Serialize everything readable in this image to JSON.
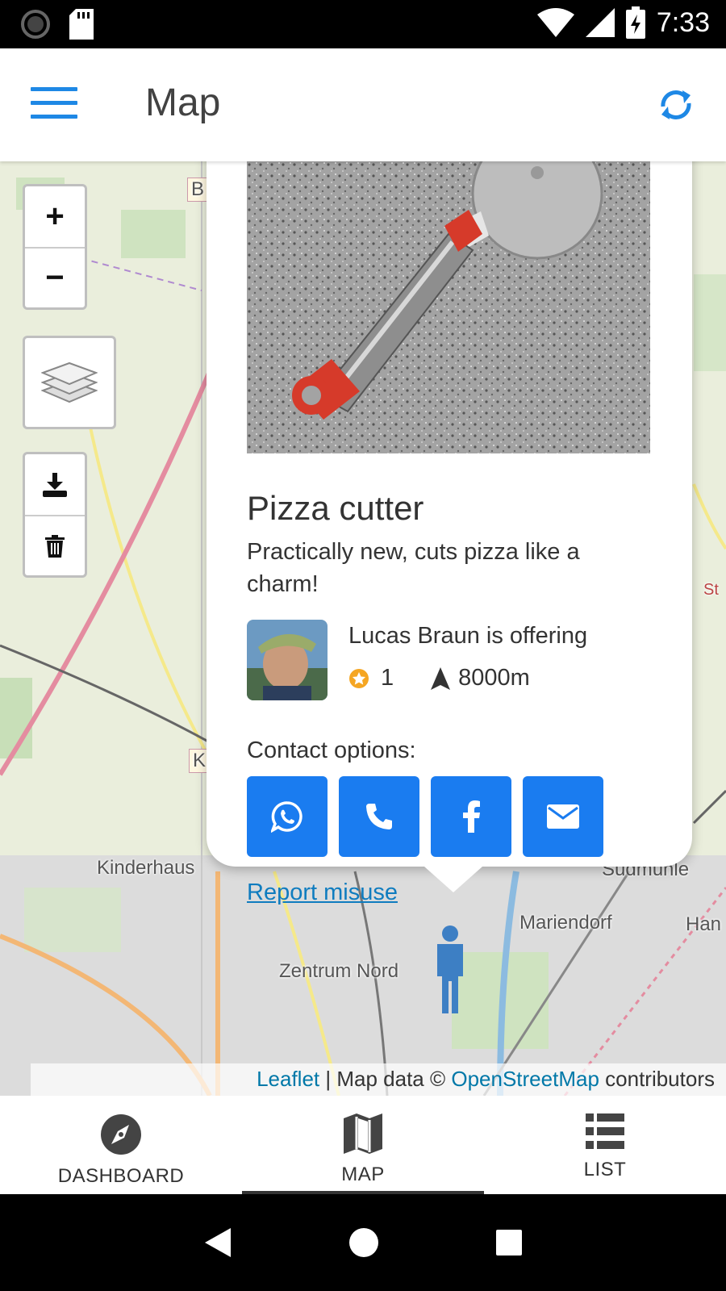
{
  "status_bar": {
    "time": "7:33",
    "icons": [
      "loading-icon",
      "sd-card-icon",
      "wifi-icon",
      "cell-signal-icon",
      "battery-charging-icon"
    ]
  },
  "app_bar": {
    "title": "Map",
    "menu_icon": "hamburger-menu-icon",
    "refresh_icon": "refresh-icon",
    "accent_color": "#1e88e5"
  },
  "map": {
    "zoom_in_label": "+",
    "zoom_out_label": "−",
    "labels": {
      "kinderhaus": "Kinderhaus",
      "zentrum_nord": "Zentrum Nord",
      "mariendorf": "Mariendorf",
      "han": "Han",
      "sudmuhle": "Sudmühle",
      "b_road": "B",
      "k_road": "K",
      "st": "St"
    },
    "attribution": {
      "leaflet": "Leaflet",
      "middle": " | Map data © ",
      "osm": "OpenStreetMap",
      "end": " contributors"
    }
  },
  "popup": {
    "item_title": "Pizza cutter",
    "item_description": "Practically new, cuts pizza like a charm!",
    "offer_text": "Lucas Braun is offering",
    "rating": "1",
    "distance": "8000m",
    "contact_label": "Contact options:",
    "contacts": [
      "whatsapp-icon",
      "phone-icon",
      "facebook-icon",
      "email-icon"
    ],
    "contact_color": "#1a7cf0",
    "report_label": "Report misuse"
  },
  "bottom_nav": {
    "tabs": [
      {
        "label": "DASHBOARD",
        "icon": "compass-icon"
      },
      {
        "label": "MAP",
        "icon": "map-icon",
        "active": true
      },
      {
        "label": "LIST",
        "icon": "list-icon"
      }
    ]
  },
  "system_nav": {
    "icons": [
      "back-icon",
      "home-icon",
      "recents-icon"
    ]
  }
}
